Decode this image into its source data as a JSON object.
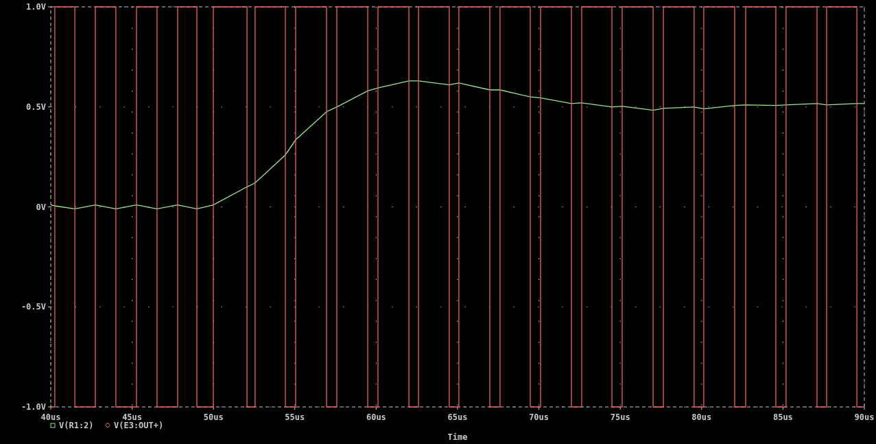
{
  "plot": {
    "chart_data": {
      "type": "line",
      "xlabel": "Time",
      "grid": true,
      "legend": true,
      "xlim": [
        40,
        90
      ],
      "ylim": [
        -1,
        1
      ],
      "xticks": [
        {
          "value": 40,
          "label": "40us"
        },
        {
          "value": 45,
          "label": "45us"
        },
        {
          "value": 50,
          "label": "50us"
        },
        {
          "value": 55,
          "label": "55us"
        },
        {
          "value": 60,
          "label": "60us"
        },
        {
          "value": 65,
          "label": "65us"
        },
        {
          "value": 70,
          "label": "70us"
        },
        {
          "value": 75,
          "label": "75us"
        },
        {
          "value": 80,
          "label": "80us"
        },
        {
          "value": 85,
          "label": "85us"
        },
        {
          "value": 90,
          "label": "90us"
        }
      ],
      "yticks": [
        {
          "value": 1,
          "label": "1.0V"
        },
        {
          "value": 0.5,
          "label": "0.5V"
        },
        {
          "value": 0,
          "label": "0V"
        },
        {
          "value": -0.5,
          "label": "-0.5V"
        },
        {
          "value": -1,
          "label": "-1.0V"
        }
      ],
      "x": [
        40,
        40.25,
        40.25,
        41.48,
        41.48,
        42.74,
        42.74,
        44.0,
        44.0,
        45.27,
        45.27,
        46.53,
        46.53,
        47.8,
        47.8,
        48.98,
        48.98,
        49.99,
        49.99,
        52.06,
        52.06,
        52.56,
        52.56,
        54.42,
        54.42,
        55.05,
        55.05,
        56.95,
        56.95,
        57.58,
        57.58,
        59.48,
        59.48,
        60.11,
        60.11,
        62.01,
        62.01,
        62.6,
        62.6,
        64.49,
        64.49,
        65.08,
        65.08,
        66.98,
        66.98,
        67.61,
        67.61,
        69.47,
        69.47,
        70.1,
        70.1,
        72.0,
        72.0,
        72.63,
        72.63,
        74.49,
        74.49,
        75.12,
        75.12,
        77.02,
        77.02,
        77.65,
        77.65,
        79.54,
        79.54,
        80.13,
        80.13,
        82.03,
        82.03,
        82.71,
        82.71,
        84.56,
        84.56,
        85.19,
        85.19,
        87.09,
        87.09,
        87.68,
        87.68,
        89.54,
        89.54,
        90
      ],
      "series": [
        {
          "name": "V(R1:2)",
          "color": "#98e898",
          "values": [
            0.01,
            0.005,
            0.005,
            -0.01,
            -0.01,
            0.01,
            0.01,
            -0.01,
            -0.01,
            0.01,
            0.01,
            -0.01,
            -0.01,
            0.01,
            0.01,
            -0.01,
            -0.01,
            0.01,
            0.01,
            0.1,
            0.1,
            0.12,
            0.12,
            0.26,
            0.26,
            0.335,
            0.335,
            0.476,
            0.476,
            0.5,
            0.5,
            0.58,
            0.58,
            0.595,
            0.595,
            0.63,
            0.63,
            0.63,
            0.63,
            0.61,
            0.61,
            0.62,
            0.62,
            0.585,
            0.585,
            0.585,
            0.585,
            0.55,
            0.55,
            0.545,
            0.545,
            0.517,
            0.517,
            0.52,
            0.52,
            0.5,
            0.5,
            0.503,
            0.503,
            0.483,
            0.483,
            0.493,
            0.493,
            0.5,
            0.5,
            0.49,
            0.49,
            0.507,
            0.507,
            0.51,
            0.51,
            0.507,
            0.507,
            0.51,
            0.51,
            0.517,
            0.517,
            0.51,
            0.51,
            0.517,
            0.517,
            0.517
          ]
        },
        {
          "name": "V(E3:OUT+)",
          "color": "#f06060",
          "values": [
            -1,
            -1,
            1,
            1,
            -1,
            -1,
            1,
            1,
            -1,
            -1,
            1,
            1,
            -1,
            -1,
            1,
            1,
            -1,
            -1,
            1,
            1,
            -1,
            -1,
            1,
            1,
            -1,
            -1,
            1,
            1,
            -1,
            -1,
            1,
            1,
            -1,
            -1,
            1,
            1,
            -1,
            -1,
            1,
            1,
            -1,
            -1,
            1,
            1,
            -1,
            -1,
            1,
            1,
            -1,
            -1,
            1,
            1,
            -1,
            -1,
            1,
            1,
            -1,
            -1,
            1,
            1,
            -1,
            -1,
            1,
            1,
            -1,
            -1,
            1,
            1,
            -1,
            -1,
            1,
            1,
            -1,
            -1,
            1,
            1,
            -1,
            -1,
            1,
            1,
            -1,
            -1
          ]
        }
      ]
    }
  }
}
